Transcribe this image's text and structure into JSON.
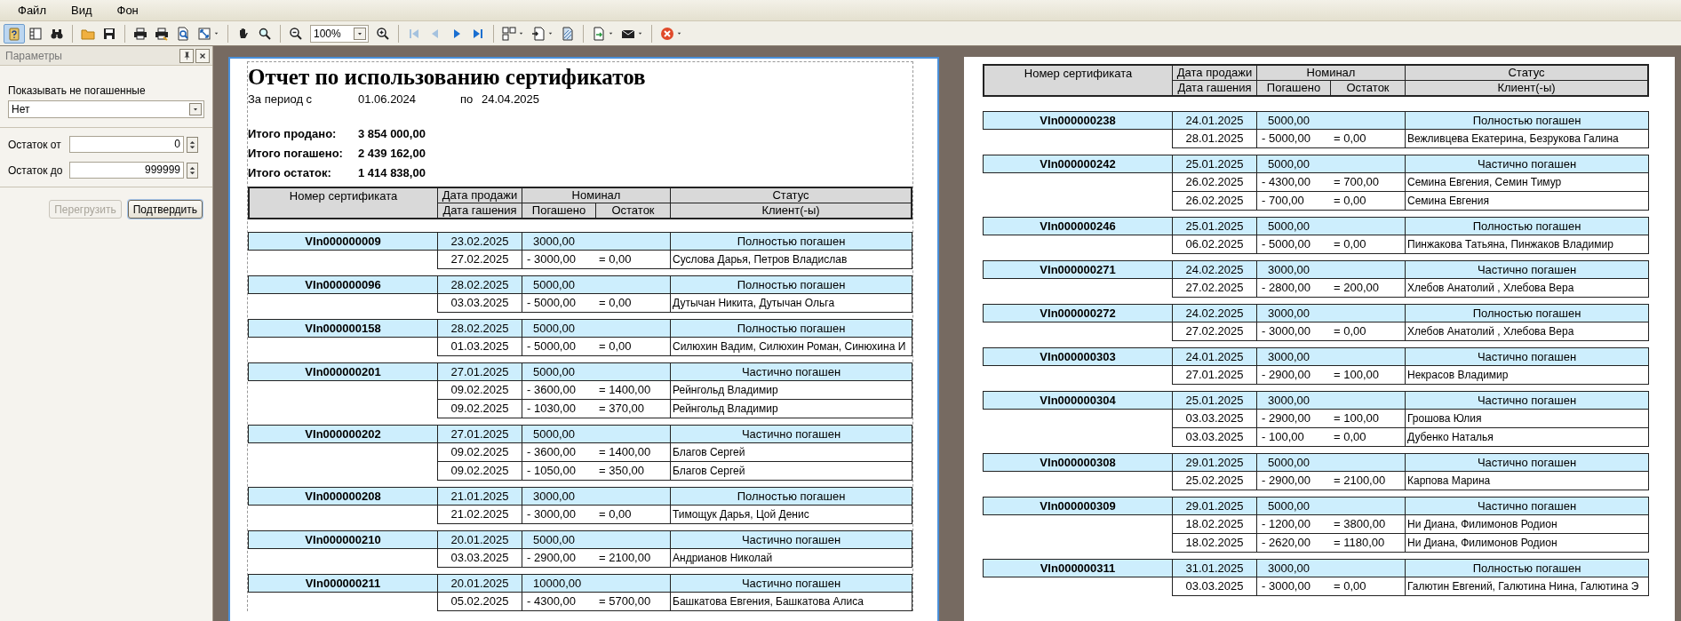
{
  "menu": [
    {
      "label": "Файл"
    },
    {
      "label": "Вид"
    },
    {
      "label": "Фон"
    }
  ],
  "toolbar": {
    "groups": [
      [
        {
          "kind": "button",
          "selected": true,
          "disabled": false
        },
        {
          "kind": "button",
          "selected": false,
          "disabled": false
        },
        {
          "kind": "button",
          "selected": false,
          "disabled": false
        }
      ],
      [
        {
          "kind": "button",
          "selected": false,
          "disabled": false
        },
        {
          "kind": "button",
          "selected": false,
          "disabled": false
        }
      ],
      [
        {
          "kind": "button",
          "selected": false,
          "disabled": false
        },
        {
          "kind": "button",
          "selected": false,
          "disabled": false
        },
        {
          "kind": "button",
          "selected": false,
          "disabled": false
        },
        {
          "kind": "dropdown",
          "selected": false,
          "disabled": false
        }
      ],
      [
        {
          "kind": "button",
          "selected": false,
          "disabled": false
        },
        {
          "kind": "button",
          "selected": false,
          "disabled": false
        }
      ],
      [
        {
          "kind": "button",
          "selected": false,
          "disabled": false
        },
        {
          "kind": "zoom_field",
          "value": "100%"
        },
        {
          "kind": "button",
          "selected": false,
          "disabled": false
        }
      ],
      [
        {
          "kind": "button",
          "selected": false,
          "disabled": true
        },
        {
          "kind": "button",
          "selected": false,
          "disabled": true
        },
        {
          "kind": "button",
          "selected": false,
          "disabled": false
        },
        {
          "kind": "button",
          "selected": false,
          "disabled": false
        }
      ],
      [
        {
          "kind": "dropdown",
          "selected": false,
          "disabled": false
        },
        {
          "kind": "dropdown",
          "selected": false,
          "disabled": false
        },
        {
          "kind": "button",
          "selected": false,
          "disabled": false
        }
      ],
      [
        {
          "kind": "dropdown",
          "selected": false,
          "disabled": false
        },
        {
          "kind": "dropdown",
          "selected": false,
          "disabled": false
        }
      ],
      [
        {
          "kind": "dropdown",
          "selected": false,
          "disabled": false
        }
      ]
    ]
  },
  "params_panel": {
    "title": "Параметры",
    "show_unredeemed": {
      "label": "Показывать не погашенные",
      "value": "Нет"
    },
    "remainder_from": {
      "label": "Остаток от",
      "value": "0"
    },
    "remainder_to": {
      "label": "Остаток до",
      "value": "999999"
    },
    "buttons": [
      {
        "label": "Перегрузить",
        "disabled": true
      },
      {
        "label": "Подтвердить",
        "disabled": false
      }
    ]
  },
  "pages": [
    {
      "selected": true,
      "report_header": {
        "title": "Отчет по использованию сертификатов",
        "period_label": "За период с",
        "period_from": "01.06.2024",
        "period_to_label": "по",
        "period_to": "24.04.2025",
        "totals": [
          {
            "label": "Итого продано:",
            "value": "3 854 000,00"
          },
          {
            "label": "Итого погашено:",
            "value": "2 439 162,00"
          },
          {
            "label": "Итого остаток:",
            "value": "1 414 838,00"
          }
        ]
      },
      "table": {
        "header": {
          "certificate": "Номер сертификата",
          "sale_date": "Дата продажи",
          "nominal": "Номинал",
          "status": "Статус",
          "redeem_date": "Дата гашения",
          "paid": "Погашено",
          "remainder": "Остаток",
          "clients": "Клиент(-ы)"
        },
        "blocks": [
          {
            "certificate": "VIn000000009",
            "sale_date": "23.02.2025",
            "nominal": "3000,00",
            "status": "Полностью погашен",
            "redemptions": [
              {
                "date": "27.02.2025",
                "paid": "- 3000,00",
                "remainder": "= 0,00",
                "clients": "Суслова Дарья, Петров Владислав"
              }
            ]
          },
          {
            "certificate": "VIn000000096",
            "sale_date": "28.02.2025",
            "nominal": "5000,00",
            "status": "Полностью погашен",
            "redemptions": [
              {
                "date": "03.03.2025",
                "paid": "- 5000,00",
                "remainder": "= 0,00",
                "clients": "Дутычан Никита, Дутычан Ольга"
              }
            ]
          },
          {
            "certificate": "VIn000000158",
            "sale_date": "28.02.2025",
            "nominal": "5000,00",
            "status": "Полностью погашен",
            "redemptions": [
              {
                "date": "01.03.2025",
                "paid": "- 5000,00",
                "remainder": "= 0,00",
                "clients": "Силюхин Вадим, Силюхин Роман, Синюхина И"
              }
            ]
          },
          {
            "certificate": "VIn000000201",
            "sale_date": "27.01.2025",
            "nominal": "5000,00",
            "status": "Частично погашен",
            "redemptions": [
              {
                "date": "09.02.2025",
                "paid": "- 3600,00",
                "remainder": "= 1400,00",
                "clients": "Рейнгольд Владимир"
              },
              {
                "date": "09.02.2025",
                "paid": "- 1030,00",
                "remainder": "= 370,00",
                "clients": "Рейнгольд Владимир"
              }
            ]
          },
          {
            "certificate": "VIn000000202",
            "sale_date": "27.01.2025",
            "nominal": "5000,00",
            "status": "Частично погашен",
            "redemptions": [
              {
                "date": "09.02.2025",
                "paid": "- 3600,00",
                "remainder": "= 1400,00",
                "clients": "Благов Сергей"
              },
              {
                "date": "09.02.2025",
                "paid": "- 1050,00",
                "remainder": "= 350,00",
                "clients": "Благов Сергей"
              }
            ]
          },
          {
            "certificate": "VIn000000208",
            "sale_date": "21.01.2025",
            "nominal": "3000,00",
            "status": "Полностью погашен",
            "redemptions": [
              {
                "date": "21.02.2025",
                "paid": "- 3000,00",
                "remainder": "= 0,00",
                "clients": "Тимощук Дарья, Цой Денис"
              }
            ]
          },
          {
            "certificate": "VIn000000210",
            "sale_date": "20.01.2025",
            "nominal": "5000,00",
            "status": "Частично погашен",
            "redemptions": [
              {
                "date": "03.03.2025",
                "paid": "- 2900,00",
                "remainder": "= 2100,00",
                "clients": "Андрианов Николай"
              }
            ]
          },
          {
            "certificate": "VIn000000211",
            "sale_date": "20.01.2025",
            "nominal": "10000,00",
            "status": "Частично погашен",
            "redemptions": [
              {
                "date": "05.02.2025",
                "paid": "- 4300,00",
                "remainder": "= 5700,00",
                "clients": "Башкатова Евгения, Башкатова Алиса"
              }
            ]
          }
        ]
      }
    },
    {
      "selected": false,
      "table": {
        "header": {
          "certificate": "Номер сертификата",
          "sale_date": "Дата продажи",
          "nominal": "Номинал",
          "status": "Статус",
          "redeem_date": "Дата гашения",
          "paid": "Погашено",
          "remainder": "Остаток",
          "clients": "Клиент(-ы)"
        },
        "blocks": [
          {
            "certificate": "VIn000000238",
            "sale_date": "24.01.2025",
            "nominal": "5000,00",
            "status": "Полностью погашен",
            "redemptions": [
              {
                "date": "28.01.2025",
                "paid": "- 5000,00",
                "remainder": "= 0,00",
                "clients": "Вежливцева Екатерина, Безрукова Галина"
              }
            ]
          },
          {
            "certificate": "VIn000000242",
            "sale_date": "25.01.2025",
            "nominal": "5000,00",
            "status": "Частично погашен",
            "redemptions": [
              {
                "date": "26.02.2025",
                "paid": "- 4300,00",
                "remainder": "= 700,00",
                "clients": "Семина Евгения, Семин Тимур"
              },
              {
                "date": "26.02.2025",
                "paid": "- 700,00",
                "remainder": "= 0,00",
                "clients": "Семина Евгения"
              }
            ]
          },
          {
            "certificate": "VIn000000246",
            "sale_date": "25.01.2025",
            "nominal": "5000,00",
            "status": "Полностью погашен",
            "redemptions": [
              {
                "date": "06.02.2025",
                "paid": "- 5000,00",
                "remainder": "= 0,00",
                "clients": "Пинжакова Татьяна, Пинжаков Владимир"
              }
            ]
          },
          {
            "certificate": "VIn000000271",
            "sale_date": "24.02.2025",
            "nominal": "3000,00",
            "status": "Частично погашен",
            "redemptions": [
              {
                "date": "27.02.2025",
                "paid": "- 2800,00",
                "remainder": "= 200,00",
                "clients": "Хлебов Анатолий , Хлебова Вера"
              }
            ]
          },
          {
            "certificate": "VIn000000272",
            "sale_date": "24.02.2025",
            "nominal": "3000,00",
            "status": "Полностью погашен",
            "redemptions": [
              {
                "date": "27.02.2025",
                "paid": "- 3000,00",
                "remainder": "= 0,00",
                "clients": "Хлебов Анатолий , Хлебова Вера"
              }
            ]
          },
          {
            "certificate": "VIn000000303",
            "sale_date": "24.01.2025",
            "nominal": "3000,00",
            "status": "Частично погашен",
            "redemptions": [
              {
                "date": "27.01.2025",
                "paid": "- 2900,00",
                "remainder": "= 100,00",
                "clients": "Некрасов Владимир"
              }
            ]
          },
          {
            "certificate": "VIn000000304",
            "sale_date": "25.01.2025",
            "nominal": "3000,00",
            "status": "Частично погашен",
            "redemptions": [
              {
                "date": "03.03.2025",
                "paid": "- 2900,00",
                "remainder": "= 100,00",
                "clients": "Грошова Юлия"
              },
              {
                "date": "03.03.2025",
                "paid": "- 100,00",
                "remainder": "= 0,00",
                "clients": "Дубенко Наталья"
              }
            ]
          },
          {
            "certificate": "VIn000000308",
            "sale_date": "29.01.2025",
            "nominal": "5000,00",
            "status": "Частично погашен",
            "redemptions": [
              {
                "date": "25.02.2025",
                "paid": "- 2900,00",
                "remainder": "= 2100,00",
                "clients": "Карпова Марина"
              }
            ]
          },
          {
            "certificate": "VIn000000309",
            "sale_date": "29.01.2025",
            "nominal": "5000,00",
            "status": "Частично погашен",
            "redemptions": [
              {
                "date": "18.02.2025",
                "paid": "- 1200,00",
                "remainder": "= 3800,00",
                "clients": "Ни Диана, Филимонов Родион"
              },
              {
                "date": "18.02.2025",
                "paid": "- 2620,00",
                "remainder": "= 1180,00",
                "clients": "Ни Диана, Филимонов Родион"
              }
            ]
          },
          {
            "certificate": "VIn000000311",
            "sale_date": "31.01.2025",
            "nominal": "3000,00",
            "status": "Полностью погашен",
            "redemptions": [
              {
                "date": "03.03.2025",
                "paid": "- 3000,00",
                "remainder": "= 0,00",
                "clients": "Галютин Евгений, Галютина Нина, Галютина Э"
              }
            ]
          }
        ]
      }
    }
  ]
}
